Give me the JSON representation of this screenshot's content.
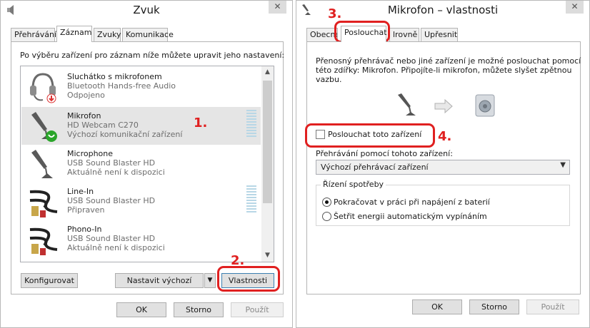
{
  "sound_window": {
    "title": "Zvuk",
    "tabs": [
      "Přehrávání",
      "Záznam",
      "Zvuky",
      "Komunikace"
    ],
    "active_tab": "Záznam",
    "instruction": "Po výběru zařízení pro záznam níže můžete upravit jeho nastavení:",
    "devices": [
      {
        "name": "Sluchátko s mikrofonem",
        "sub": "Bluetooth Hands-free Audio",
        "status": "Odpojeno",
        "icon": "headset-icon"
      },
      {
        "name": "Mikrofon",
        "sub": "HD Webcam C270",
        "status": "Výchozí komunikační zařízení",
        "icon": "microphone-icon"
      },
      {
        "name": "Microphone",
        "sub": "USB Sound Blaster HD",
        "status": "Aktuálně není k dispozici",
        "icon": "microphone-icon"
      },
      {
        "name": "Line-In",
        "sub": "USB Sound Blaster HD",
        "status": "Připraven",
        "icon": "rca-cable-icon"
      },
      {
        "name": "Phono-In",
        "sub": "USB Sound Blaster HD",
        "status": "Aktuálně není k dispozici",
        "icon": "rca-cable-icon"
      }
    ],
    "buttons": {
      "configure": "Konfigurovat",
      "set_default": "Nastavit výchozí",
      "properties": "Vlastnosti",
      "ok": "OK",
      "cancel": "Storno",
      "apply": "Použít"
    },
    "annotations": {
      "one": "1.",
      "two": "2."
    }
  },
  "mic_window": {
    "title": "Mikrofon – vlastnosti",
    "tabs": [
      "Obecné",
      "Poslouchat",
      "Úrovně",
      "Upřesnit"
    ],
    "tab_display": [
      "Obecne",
      "Poslouchat",
      "lrovně",
      "Upřesnit"
    ],
    "active_tab": "Poslouchat",
    "description": [
      "Přenosný přehrávač nebo jiné zařízení je možné poslouchat pomocí",
      "této zdířky: Mikrofon. Připojíte-li mikrofon, můžete slyšet zpětnou",
      "vazbu."
    ],
    "listen_checkbox": "Poslouchat toto zařízení",
    "listen_checked": false,
    "playback_label": "Přehrávání pomocí tohoto zařízení:",
    "playback_value": "Výchozí přehrávací zařízení",
    "power_group": "Řízení spotřeby",
    "power_options": [
      "Pokračovat v práci při napájení z baterií",
      "Šetřit energii automatickým vypínáním"
    ],
    "power_selected": 0,
    "buttons": {
      "ok": "OK",
      "cancel": "Storno",
      "apply": "Použít"
    },
    "annotations": {
      "three": "3.",
      "four": "4."
    }
  },
  "colors": {
    "annotation": "#e02020",
    "selected_row": "#e5e5e5",
    "meter": "#b8d7e6"
  }
}
